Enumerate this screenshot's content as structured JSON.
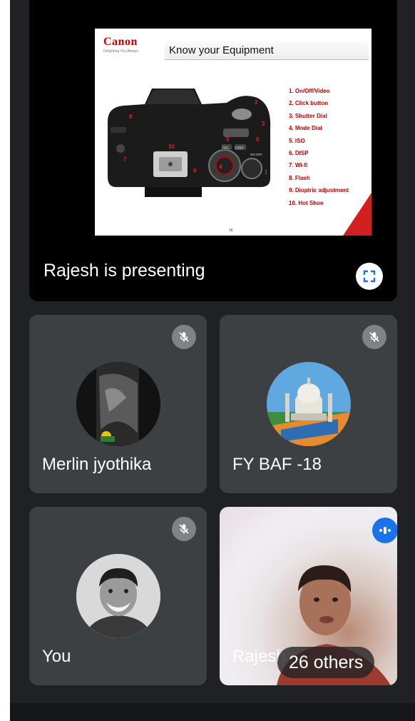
{
  "presentation": {
    "presenting_label": "Rajesh is presenting",
    "fullscreen_icon": "fullscreen-icon",
    "slide": {
      "brand": "Canon",
      "tagline": "Delighting You Always",
      "title": "Know your Equipment",
      "parts": [
        "1.  On/Off/Video",
        "2.  Click button",
        "3.  Shutter Dial",
        "4.  Mode Dial",
        "5.  ISO",
        "6.  DISP",
        "7.  Wi-fi",
        "8.  Flash",
        "9.  Dioptric adjustment",
        "10. Hot Shoe"
      ],
      "camera_callouts": [
        "1",
        "2",
        "3",
        "4",
        "5",
        "6",
        "7",
        "8",
        "9",
        "10"
      ],
      "camera_button_labels": {
        "iso": "ISO",
        "disp": "DISP",
        "on_off": "ON OFF"
      },
      "page_number": "16"
    }
  },
  "participants": [
    {
      "name": "Merlin jyothika",
      "muted": true
    },
    {
      "name": "FY BAF -18",
      "muted": true
    },
    {
      "name": "You",
      "muted": true
    },
    {
      "name": "Rajesh",
      "speaking": true,
      "others_label": "26 others"
    }
  ],
  "icons": {
    "mic_off": "mic-off-icon",
    "speaking": "audio-level-icon",
    "fullscreen": "fullscreen-icon"
  },
  "colors": {
    "background": "#202124",
    "tile": "#3c4043",
    "accent_blue": "#1a73e8",
    "slide_red": "#c00000"
  }
}
